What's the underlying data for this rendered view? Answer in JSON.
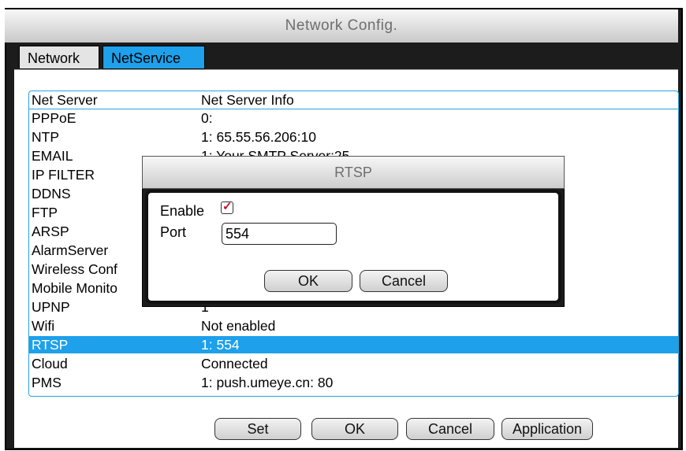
{
  "window": {
    "title": "Network Config."
  },
  "tabs": [
    {
      "label": "Network"
    },
    {
      "label": "NetService"
    }
  ],
  "table": {
    "headers": [
      "Net Server",
      "Net Server Info"
    ],
    "rows": [
      {
        "name": "PPPoE",
        "info": "0:"
      },
      {
        "name": "NTP",
        "info": "1: 65.55.56.206:10"
      },
      {
        "name": "EMAIL",
        "info": "1: Your SMTP Server:25"
      },
      {
        "name": "IP FILTER",
        "info": ""
      },
      {
        "name": "DDNS",
        "info": ""
      },
      {
        "name": "FTP",
        "info": ""
      },
      {
        "name": "ARSP",
        "info": ""
      },
      {
        "name": "AlarmServer",
        "info": ""
      },
      {
        "name": "Wireless Conf",
        "info": ""
      },
      {
        "name": "Mobile Monito",
        "info": ""
      },
      {
        "name": "UPNP",
        "info": "1"
      },
      {
        "name": "Wifi",
        "info": "Not enabled"
      },
      {
        "name": "RTSP",
        "info": "1: 554"
      },
      {
        "name": "Cloud",
        "info": "Connected"
      },
      {
        "name": "PMS",
        "info": "1: push.umeye.cn: 80"
      }
    ],
    "selected_index": 12
  },
  "buttons": {
    "set": "Set",
    "ok": "OK",
    "cancel": "Cancel",
    "application": "Application"
  },
  "dialog": {
    "title": "RTSP",
    "enable_label": "Enable",
    "enable_checked": true,
    "port_label": "Port",
    "port_value": "554",
    "ok": "OK",
    "cancel": "Cancel"
  },
  "colors": {
    "accent": "#1ea0ea",
    "frame": "#1c1c1c",
    "check": "#c8102e"
  }
}
